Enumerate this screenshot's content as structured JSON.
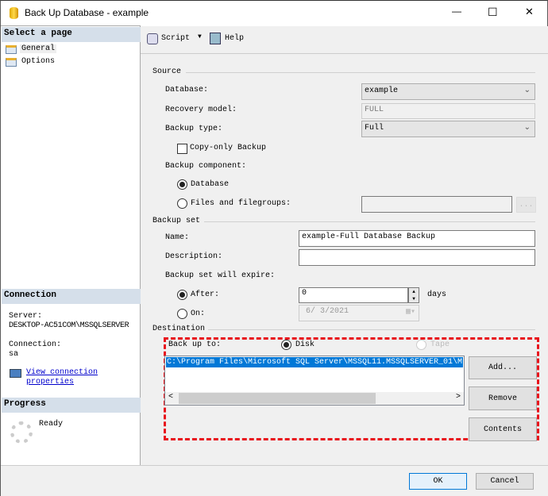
{
  "window": {
    "title": "Back Up Database - example",
    "minimize": "—",
    "maximize": "☐",
    "close": "✕"
  },
  "sidebar": {
    "select_header": "Select a page",
    "pages": [
      {
        "label": "General"
      },
      {
        "label": "Options"
      }
    ],
    "connection_header": "Connection",
    "server_label": "Server:",
    "server_value": "DESKTOP-AC51COM\\MSSQLSERVER",
    "connection_label": "Connection:",
    "connection_value": "sa",
    "view_link_1": "View connection",
    "view_link_2": "properties",
    "progress_header": "Progress",
    "progress_status": "Ready"
  },
  "toolbar": {
    "script": "Script",
    "help": "Help"
  },
  "source": {
    "title": "Source",
    "database_label": "Database:",
    "database_value": "example",
    "recovery_label": "Recovery model:",
    "recovery_value": "FULL",
    "type_label": "Backup type:",
    "type_value": "Full",
    "copy_only": "Copy-only Backup",
    "component_label": "Backup component:",
    "component_database": "Database",
    "component_files": "Files and filegroups:",
    "browse": "..."
  },
  "backup_set": {
    "title": "Backup set",
    "name_label": "Name:",
    "name_value": "example-Full Database Backup",
    "desc_label": "Description:",
    "desc_value": "",
    "expire_label": "Backup set will expire:",
    "after_label": "After:",
    "after_value": "0",
    "days": "days",
    "on_label": "On:",
    "on_value": "6/ 3/2021"
  },
  "destination": {
    "title": "Destination",
    "backup_to": "Back up to:",
    "disk": "Disk",
    "tape": "Tape",
    "paths": [
      "C:\\Program Files\\Microsoft SQL Server\\MSSQL11.MSSQLSERVER_01\\M"
    ],
    "add": "Add...",
    "remove": "Remove",
    "contents": "Contents"
  },
  "footer": {
    "ok": "OK",
    "cancel": "Cancel"
  }
}
